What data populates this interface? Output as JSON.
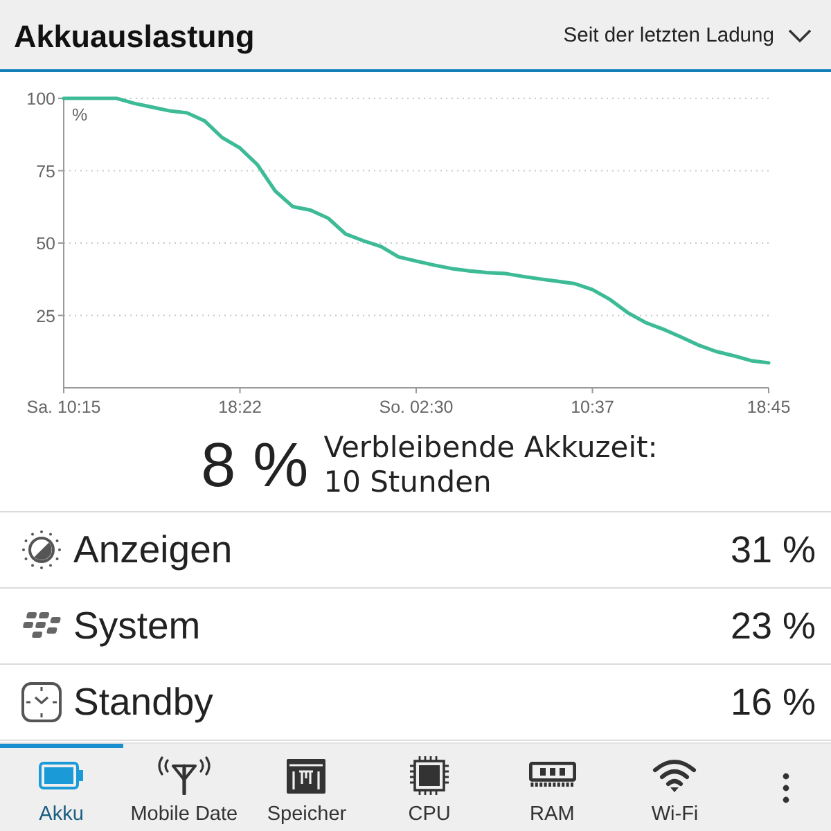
{
  "header": {
    "title": "Akkuauslastung",
    "period_selector": {
      "label": "Seit der letzten Ladung"
    }
  },
  "chart": {
    "chart_data": {
      "type": "line",
      "ylabel": "%",
      "grid": true,
      "ylim": [
        0,
        100
      ],
      "yticks": [
        25,
        50,
        75,
        100
      ],
      "categories": [
        "Sa. 10:15",
        null,
        null,
        null,
        null,
        null,
        null,
        null,
        null,
        null,
        "18:22",
        null,
        null,
        null,
        null,
        null,
        null,
        null,
        null,
        null,
        "So. 02:30",
        null,
        null,
        null,
        null,
        null,
        null,
        null,
        null,
        null,
        "10:37",
        null,
        null,
        null,
        null,
        null,
        null,
        null,
        null,
        null,
        "18:45"
      ],
      "values": [
        100,
        100,
        100,
        100,
        98.3,
        97.0,
        95.7,
        95.0,
        92.2,
        86.4,
        82.8,
        77.0,
        68.0,
        62.6,
        61.4,
        58.6,
        53.1,
        50.8,
        48.8,
        45.2,
        43.8,
        42.4,
        41.2,
        40.4,
        39.8,
        39.5,
        38.5,
        37.6,
        36.8,
        36.0,
        33.9,
        30.5,
        26.0,
        22.6,
        20.3,
        17.6,
        14.8,
        12.6,
        11.1,
        9.4,
        8.6
      ]
    }
  },
  "summary": {
    "percent": "8 %",
    "remaining_label": "Verbleibende Akkuzeit:",
    "remaining_value": "10 Stunden"
  },
  "usage": [
    {
      "kind": "display",
      "name": "Anzeigen",
      "share": "31 %"
    },
    {
      "kind": "system",
      "name": "System",
      "share": "23 %"
    },
    {
      "kind": "standby",
      "name": "Standby",
      "share": "16 %"
    }
  ],
  "tabs": [
    {
      "kind": "battery",
      "label": "Akku",
      "selected": true
    },
    {
      "kind": "antenna",
      "label": "Mobile Date",
      "selected": false
    },
    {
      "kind": "storage",
      "label": "Speicher",
      "selected": false
    },
    {
      "kind": "cpu",
      "label": "CPU",
      "selected": false
    },
    {
      "kind": "ram",
      "label": "RAM",
      "selected": false
    },
    {
      "kind": "wifi",
      "label": "Wi-Fi",
      "selected": false
    }
  ]
}
